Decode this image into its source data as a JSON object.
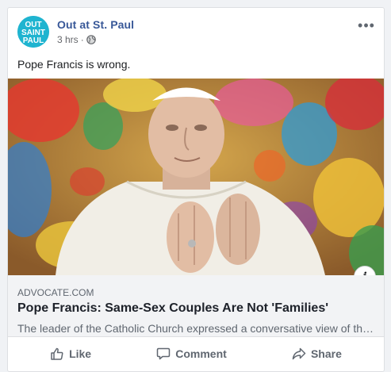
{
  "post": {
    "page_name": "Out at St. Paul",
    "time": "3 hrs",
    "separator": "·",
    "text": "Pope Francis is wrong.",
    "avatar_text": [
      "OUT",
      "SAINT",
      "PAUL"
    ],
    "more_label": "•••"
  },
  "link": {
    "domain": "ADVOCATE.COM",
    "title": "Pope Francis: Same-Sex Couples Are Not 'Families'",
    "description": "The leader of the Catholic Church expressed a conversative view of the...",
    "info_label": "i"
  },
  "actions": {
    "like": "Like",
    "comment": "Comment",
    "share": "Share"
  },
  "icons": [
    "globe-icon",
    "more-icon",
    "info-icon",
    "like-icon",
    "comment-icon",
    "share-icon"
  ],
  "colors": {
    "page_name": "#385898",
    "avatar_bg": "#1fb4d0",
    "link_box_bg": "#f2f3f5",
    "action_text": "#606770"
  }
}
